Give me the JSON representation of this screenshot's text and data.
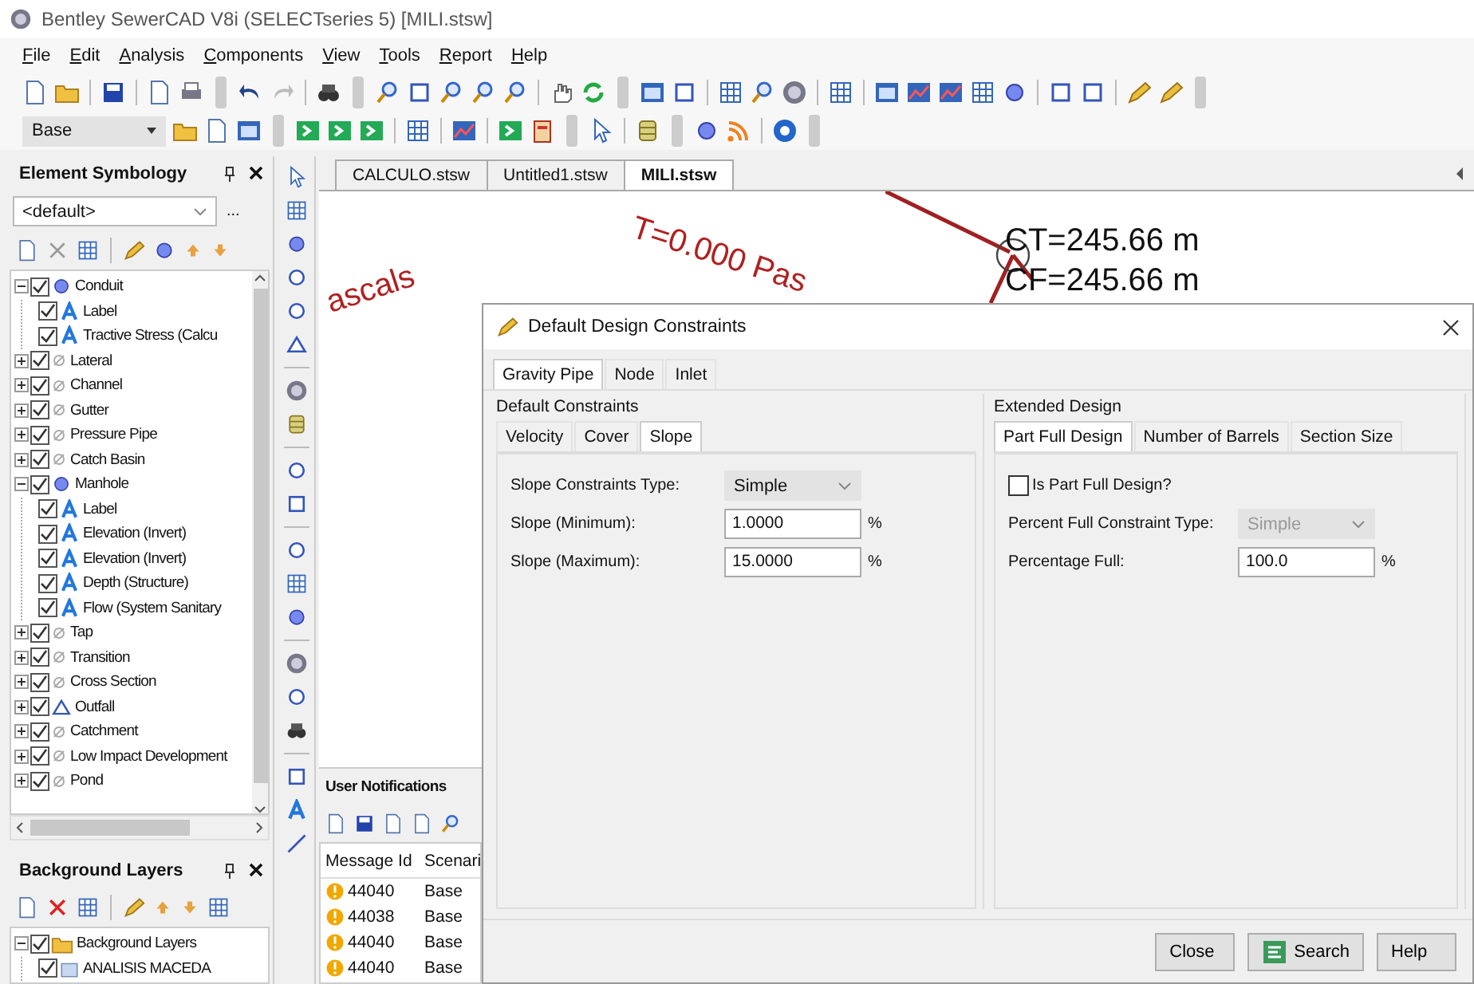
{
  "window": {
    "title": "Bentley SewerCAD V8i (SELECTseries 5) [MILI.stsw]"
  },
  "menu": [
    "File",
    "Edit",
    "Analysis",
    "Components",
    "View",
    "Tools",
    "Report",
    "Help"
  ],
  "toolbar": {
    "scenario": "Base"
  },
  "element_symbology": {
    "title": "Element Symbology",
    "combo": "<default>",
    "more_button": "...",
    "tree": [
      {
        "label": "Conduit",
        "kind": "conduit",
        "checked": true,
        "expanded": true,
        "children": [
          {
            "label": "Label",
            "kind": "label",
            "checked": true
          },
          {
            "label": "Tractive Stress (Calcu",
            "kind": "label",
            "checked": true
          }
        ]
      },
      {
        "label": "Lateral",
        "kind": "element",
        "checked": true,
        "expanded": false
      },
      {
        "label": "Channel",
        "kind": "element",
        "checked": true,
        "expanded": false
      },
      {
        "label": "Gutter",
        "kind": "element",
        "checked": true,
        "expanded": false
      },
      {
        "label": "Pressure Pipe",
        "kind": "element",
        "checked": true,
        "expanded": false
      },
      {
        "label": "Catch Basin",
        "kind": "element",
        "checked": true,
        "expanded": false
      },
      {
        "label": "Manhole",
        "kind": "manhole",
        "checked": true,
        "expanded": true,
        "children": [
          {
            "label": "Label",
            "kind": "label",
            "checked": true
          },
          {
            "label": "Elevation (Invert)",
            "kind": "label",
            "checked": true
          },
          {
            "label": "Elevation (Invert)",
            "kind": "label",
            "checked": true
          },
          {
            "label": "Depth (Structure)",
            "kind": "label",
            "checked": true
          },
          {
            "label": "Flow (System Sanitary",
            "kind": "label",
            "checked": true
          }
        ]
      },
      {
        "label": "Tap",
        "kind": "element",
        "checked": true,
        "expanded": false
      },
      {
        "label": "Transition",
        "kind": "element",
        "checked": true,
        "expanded": false
      },
      {
        "label": "Cross Section",
        "kind": "element",
        "checked": true,
        "expanded": false
      },
      {
        "label": "Outfall",
        "kind": "outfall",
        "checked": true,
        "expanded": false
      },
      {
        "label": "Catchment",
        "kind": "element",
        "checked": true,
        "expanded": false
      },
      {
        "label": "Low Impact Development",
        "kind": "element",
        "checked": true,
        "expanded": false
      },
      {
        "label": "Pond",
        "kind": "element",
        "checked": true,
        "expanded": false
      }
    ]
  },
  "background_layers": {
    "title": "Background Layers",
    "tree": [
      {
        "label": "Background Layers",
        "kind": "folder",
        "checked": true,
        "expanded": true,
        "children": [
          {
            "label": "ANALISIS MACEDA",
            "kind": "layer",
            "checked": true
          }
        ]
      }
    ]
  },
  "document_tabs": [
    {
      "label": "CALCULO.stsw",
      "selected": false
    },
    {
      "label": "Untitled1.stsw",
      "selected": false
    },
    {
      "label": "MILI.stsw",
      "selected": true
    }
  ],
  "canvas_labels": [
    {
      "text": "ascals",
      "kind": "annotation"
    },
    {
      "text": "T=0.000 Pas",
      "kind": "annotation"
    },
    {
      "text": "CT=245.66 m",
      "kind": "elevation"
    },
    {
      "text": "CF=245.66 m",
      "kind": "elevation"
    }
  ],
  "user_notifications": {
    "title": "User Notifications",
    "columns": [
      "Message Id",
      "Scenari"
    ],
    "rows": [
      {
        "message_id": "44040",
        "scenario": "Base"
      },
      {
        "message_id": "44038",
        "scenario": "Base"
      },
      {
        "message_id": "44040",
        "scenario": "Base"
      },
      {
        "message_id": "44040",
        "scenario": "Base"
      }
    ]
  },
  "dialog": {
    "title": "Default Design Constraints",
    "tabs": [
      {
        "label": "Gravity Pipe",
        "selected": true
      },
      {
        "label": "Node",
        "selected": false
      },
      {
        "label": "Inlet",
        "selected": false
      }
    ],
    "default_constraints": {
      "title": "Default Constraints",
      "tabs": [
        {
          "label": "Velocity",
          "selected": false
        },
        {
          "label": "Cover",
          "selected": false
        },
        {
          "label": "Slope",
          "selected": true
        }
      ],
      "fields": [
        {
          "label": "Slope Constraints Type:",
          "kind": "select",
          "value": "Simple",
          "disabled": false
        },
        {
          "label": "Slope (Minimum):",
          "kind": "number",
          "value": "1.0000",
          "unit": "%"
        },
        {
          "label": "Slope (Maximum):",
          "kind": "number",
          "value": "15.0000",
          "unit": "%"
        }
      ]
    },
    "extended_design": {
      "title": "Extended Design",
      "tabs": [
        {
          "label": "Part Full Design",
          "selected": true
        },
        {
          "label": "Number of Barrels",
          "selected": false
        },
        {
          "label": "Section Size",
          "selected": false
        }
      ],
      "checkbox": {
        "label": "Is Part Full Design?",
        "checked": false
      },
      "fields": [
        {
          "label": "Percent Full Constraint Type:",
          "kind": "select",
          "value": "Simple",
          "disabled": true
        },
        {
          "label": "Percentage Full:",
          "kind": "number",
          "value": "100.0",
          "unit": "%"
        }
      ]
    },
    "buttons": [
      {
        "label": "Close",
        "kind": "plain"
      },
      {
        "label": "Search",
        "kind": "icon"
      },
      {
        "label": "Help",
        "kind": "plain"
      }
    ]
  }
}
